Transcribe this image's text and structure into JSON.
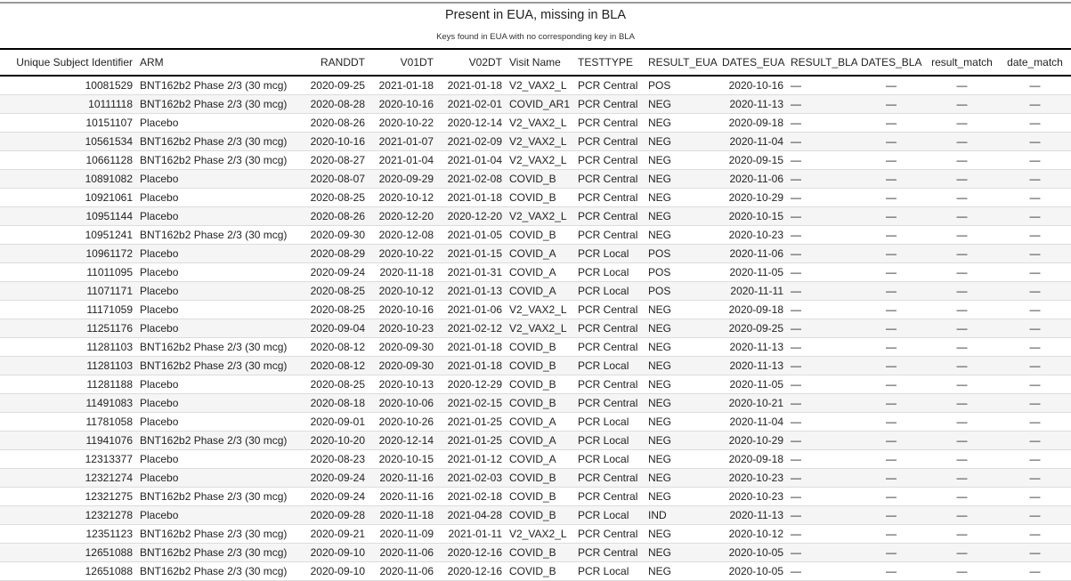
{
  "title": "Present in EUA, missing in BLA",
  "subtitle": "Keys found in EUA with no corresponding key in BLA",
  "columns": [
    "Unique Subject Identifier",
    "ARM",
    "RANDDT",
    "V01DT",
    "V02DT",
    "Visit Name",
    "TESTTYPE",
    "RESULT_EUA",
    "DATES_EUA",
    "RESULT_BLA",
    "DATES_BLA",
    "result_match",
    "date_match"
  ],
  "rows": [
    [
      "10081529",
      "BNT162b2 Phase 2/3 (30 mcg)",
      "2020-09-25",
      "2021-01-18",
      "2021-01-18",
      "V2_VAX2_L",
      "PCR Central",
      "POS",
      "2020-10-16",
      "—",
      "—",
      "—",
      "—"
    ],
    [
      "10111118",
      "BNT162b2 Phase 2/3 (30 mcg)",
      "2020-08-28",
      "2020-10-16",
      "2021-02-01",
      "COVID_AR1",
      "PCR Central",
      "NEG",
      "2020-11-13",
      "—",
      "—",
      "—",
      "—"
    ],
    [
      "10151107",
      "Placebo",
      "2020-08-26",
      "2020-10-22",
      "2020-12-14",
      "V2_VAX2_L",
      "PCR Central",
      "NEG",
      "2020-09-18",
      "—",
      "—",
      "—",
      "—"
    ],
    [
      "10561534",
      "BNT162b2 Phase 2/3 (30 mcg)",
      "2020-10-16",
      "2021-01-07",
      "2021-02-09",
      "V2_VAX2_L",
      "PCR Central",
      "NEG",
      "2020-11-04",
      "—",
      "—",
      "—",
      "—"
    ],
    [
      "10661128",
      "BNT162b2 Phase 2/3 (30 mcg)",
      "2020-08-27",
      "2021-01-04",
      "2021-01-04",
      "V2_VAX2_L",
      "PCR Central",
      "NEG",
      "2020-09-15",
      "—",
      "—",
      "—",
      "—"
    ],
    [
      "10891082",
      "Placebo",
      "2020-08-07",
      "2020-09-29",
      "2021-02-08",
      "COVID_B",
      "PCR Central",
      "NEG",
      "2020-11-06",
      "—",
      "—",
      "—",
      "—"
    ],
    [
      "10921061",
      "Placebo",
      "2020-08-25",
      "2020-10-12",
      "2021-01-18",
      "COVID_B",
      "PCR Central",
      "NEG",
      "2020-10-29",
      "—",
      "—",
      "—",
      "—"
    ],
    [
      "10951144",
      "Placebo",
      "2020-08-26",
      "2020-12-20",
      "2020-12-20",
      "V2_VAX2_L",
      "PCR Central",
      "NEG",
      "2020-10-15",
      "—",
      "—",
      "—",
      "—"
    ],
    [
      "10951241",
      "BNT162b2 Phase 2/3 (30 mcg)",
      "2020-09-30",
      "2020-12-08",
      "2021-01-05",
      "COVID_B",
      "PCR Central",
      "NEG",
      "2020-10-23",
      "—",
      "—",
      "—",
      "—"
    ],
    [
      "10961172",
      "Placebo",
      "2020-08-29",
      "2020-10-22",
      "2021-01-15",
      "COVID_A",
      "PCR Local",
      "POS",
      "2020-11-06",
      "—",
      "—",
      "—",
      "—"
    ],
    [
      "11011095",
      "Placebo",
      "2020-09-24",
      "2020-11-18",
      "2021-01-31",
      "COVID_A",
      "PCR Local",
      "POS",
      "2020-11-05",
      "—",
      "—",
      "—",
      "—"
    ],
    [
      "11071171",
      "Placebo",
      "2020-08-25",
      "2020-10-12",
      "2021-01-13",
      "COVID_A",
      "PCR Local",
      "POS",
      "2020-11-11",
      "—",
      "—",
      "—",
      "—"
    ],
    [
      "11171059",
      "Placebo",
      "2020-08-25",
      "2020-10-16",
      "2021-01-06",
      "V2_VAX2_L",
      "PCR Central",
      "NEG",
      "2020-09-18",
      "—",
      "—",
      "—",
      "—"
    ],
    [
      "11251176",
      "Placebo",
      "2020-09-04",
      "2020-10-23",
      "2021-02-12",
      "V2_VAX2_L",
      "PCR Central",
      "NEG",
      "2020-09-25",
      "—",
      "—",
      "—",
      "—"
    ],
    [
      "11281103",
      "BNT162b2 Phase 2/3 (30 mcg)",
      "2020-08-12",
      "2020-09-30",
      "2021-01-18",
      "COVID_B",
      "PCR Central",
      "NEG",
      "2020-11-13",
      "—",
      "—",
      "—",
      "—"
    ],
    [
      "11281103",
      "BNT162b2 Phase 2/3 (30 mcg)",
      "2020-08-12",
      "2020-09-30",
      "2021-01-18",
      "COVID_B",
      "PCR Local",
      "NEG",
      "2020-11-13",
      "—",
      "—",
      "—",
      "—"
    ],
    [
      "11281188",
      "Placebo",
      "2020-08-25",
      "2020-10-13",
      "2020-12-29",
      "COVID_B",
      "PCR Central",
      "NEG",
      "2020-11-05",
      "—",
      "—",
      "—",
      "—"
    ],
    [
      "11491083",
      "Placebo",
      "2020-08-18",
      "2020-10-06",
      "2021-02-15",
      "COVID_B",
      "PCR Central",
      "NEG",
      "2020-10-21",
      "—",
      "—",
      "—",
      "—"
    ],
    [
      "11781058",
      "Placebo",
      "2020-09-01",
      "2020-10-26",
      "2021-01-25",
      "COVID_A",
      "PCR Local",
      "NEG",
      "2020-11-04",
      "—",
      "—",
      "—",
      "—"
    ],
    [
      "11941076",
      "BNT162b2 Phase 2/3 (30 mcg)",
      "2020-10-20",
      "2020-12-14",
      "2021-01-25",
      "COVID_A",
      "PCR Local",
      "NEG",
      "2020-10-29",
      "—",
      "—",
      "—",
      "—"
    ],
    [
      "12313377",
      "Placebo",
      "2020-08-23",
      "2020-10-15",
      "2021-01-12",
      "COVID_A",
      "PCR Local",
      "NEG",
      "2020-09-18",
      "—",
      "—",
      "—",
      "—"
    ],
    [
      "12321274",
      "Placebo",
      "2020-09-24",
      "2020-11-16",
      "2021-02-03",
      "COVID_B",
      "PCR Central",
      "NEG",
      "2020-10-23",
      "—",
      "—",
      "—",
      "—"
    ],
    [
      "12321275",
      "BNT162b2 Phase 2/3 (30 mcg)",
      "2020-09-24",
      "2020-11-16",
      "2021-02-18",
      "COVID_B",
      "PCR Central",
      "NEG",
      "2020-10-23",
      "—",
      "—",
      "—",
      "—"
    ],
    [
      "12321278",
      "Placebo",
      "2020-09-28",
      "2020-11-18",
      "2021-04-28",
      "COVID_B",
      "PCR Local",
      "IND",
      "2020-11-13",
      "—",
      "—",
      "—",
      "—"
    ],
    [
      "12351123",
      "BNT162b2 Phase 2/3 (30 mcg)",
      "2020-09-21",
      "2020-11-09",
      "2021-01-11",
      "V2_VAX2_L",
      "PCR Central",
      "NEG",
      "2020-10-12",
      "—",
      "—",
      "—",
      "—"
    ],
    [
      "12651088",
      "BNT162b2 Phase 2/3 (30 mcg)",
      "2020-09-10",
      "2020-11-06",
      "2020-12-16",
      "COVID_B",
      "PCR Central",
      "NEG",
      "2020-10-05",
      "—",
      "—",
      "—",
      "—"
    ],
    [
      "12651088",
      "BNT162b2 Phase 2/3 (30 mcg)",
      "2020-09-10",
      "2020-11-06",
      "2020-12-16",
      "COVID_B",
      "PCR Local",
      "NEG",
      "2020-10-05",
      "—",
      "—",
      "—",
      "—"
    ]
  ]
}
